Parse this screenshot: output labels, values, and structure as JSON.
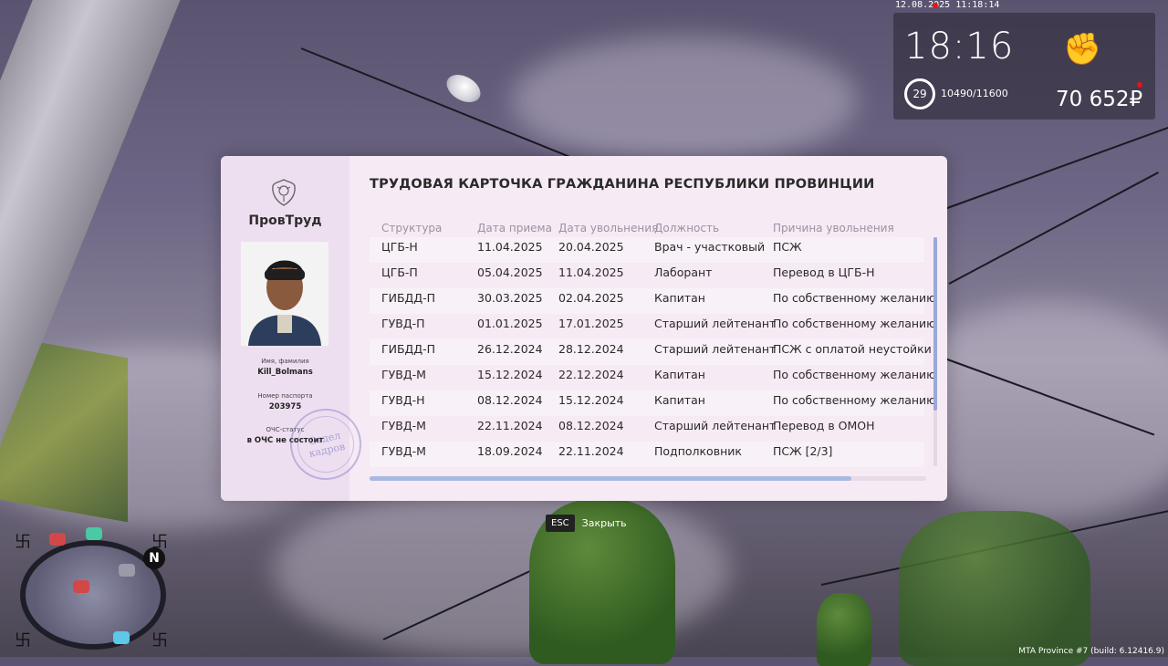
{
  "hud": {
    "datetime": "12.08.2025 11:18:14",
    "time": "18:16",
    "level": "29",
    "exp": "10490/11600",
    "money": "70 652₽",
    "fist_icon": "fist-icon"
  },
  "card": {
    "org_name": "ПровТруд",
    "title": "ТРУДОВАЯ КАРТОЧКА ГРАЖДАНИНА РЕСПУБЛИКИ ПРОВИНЦИИ",
    "name_label": "Имя, фамилия",
    "name_value": "Kill_Bolmans",
    "passport_label": "Номер паспорта",
    "passport_value": "203975",
    "ochs_label": "ОЧС-статус",
    "ochs_value": "в ОЧС не состоит",
    "stamp_text": "Отдел кадров",
    "columns": [
      "Структура",
      "Дата приема",
      "Дата увольнения",
      "Должность",
      "Причина увольнения"
    ],
    "rows": [
      [
        "ЦГБ-Н",
        "11.04.2025",
        "20.04.2025",
        "Врач - участковый",
        "ПСЖ"
      ],
      [
        "ЦГБ-П",
        "05.04.2025",
        "11.04.2025",
        "Лаборант",
        "Перевод в ЦГБ-Н"
      ],
      [
        "ГИБДД-П",
        "30.03.2025",
        "02.04.2025",
        "Капитан",
        "По собственному желанию"
      ],
      [
        "ГУВД-П",
        "01.01.2025",
        "17.01.2025",
        "Старший лейтенант",
        "По собственному желанию"
      ],
      [
        "ГИБДД-П",
        "26.12.2024",
        "28.12.2024",
        "Старший лейтенант",
        "ПСЖ с оплатой неустойки"
      ],
      [
        "ГУВД-М",
        "15.12.2024",
        "22.12.2024",
        "Капитан",
        "По собственному желанию"
      ],
      [
        "ГУВД-Н",
        "08.12.2024",
        "15.12.2024",
        "Капитан",
        "По собственному желанию"
      ],
      [
        "ГУВД-М",
        "22.11.2024",
        "08.12.2024",
        "Старший лейтенант",
        "Перевод в ОМОН"
      ],
      [
        "ГУВД-М",
        "18.09.2024",
        "22.11.2024",
        "Подполковник",
        "ПСЖ [2/3]"
      ]
    ]
  },
  "close_hint": {
    "key": "ESC",
    "label": "Закрыть"
  },
  "minimap": {
    "north": "N"
  },
  "build": "MTA Province #7 (build: 6.12416.9)"
}
